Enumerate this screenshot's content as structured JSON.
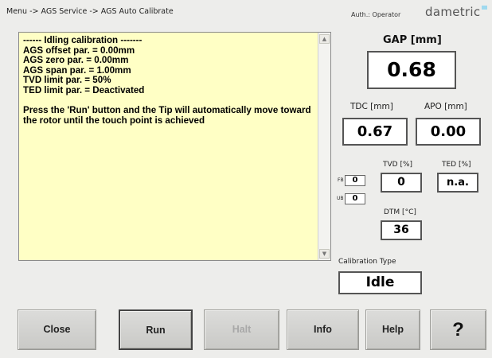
{
  "breadcrumb": "Menu -> AGS Service -> AGS Auto Calibrate",
  "auth_label": "Auth.: Operator",
  "brand": "dametric",
  "log": {
    "lines": "------ Idling calibration -------\nAGS offset par. = 0.00mm\nAGS zero par. = 0.00mm\nAGS span par. = 1.00mm\nTVD limit par. = 50%\nTED limit par. = Deactivated\n\nPress the 'Run' button and the Tip will automatically move toward the rotor until the touch point is achieved",
    "scroll_up_icon": "▲",
    "scroll_down_icon": "▼"
  },
  "gap": {
    "label": "GAP [mm]",
    "value": "0.68"
  },
  "tdc": {
    "label": "TDC [mm]",
    "value": "0.67"
  },
  "apo": {
    "label": "APO [mm]",
    "value": "0.00"
  },
  "tvd": {
    "label": "TVD [%]",
    "value": "0"
  },
  "ted": {
    "label": "TED [%]",
    "value": "n.a."
  },
  "fb": {
    "label": "FB",
    "value": "0"
  },
  "ub": {
    "label": "UB",
    "value": "0"
  },
  "dtm": {
    "label": "DTM [°C]",
    "value": "36"
  },
  "calibration": {
    "label": "Calibration Type",
    "value": "Idle"
  },
  "buttons": {
    "close": "Close",
    "run": "Run",
    "halt": "Halt",
    "info": "Info",
    "help": "Help",
    "question": "?"
  },
  "colors": {
    "background": "#ededeb",
    "log_background": "#ffffc5",
    "brand_accent": "#9fd9ef"
  }
}
